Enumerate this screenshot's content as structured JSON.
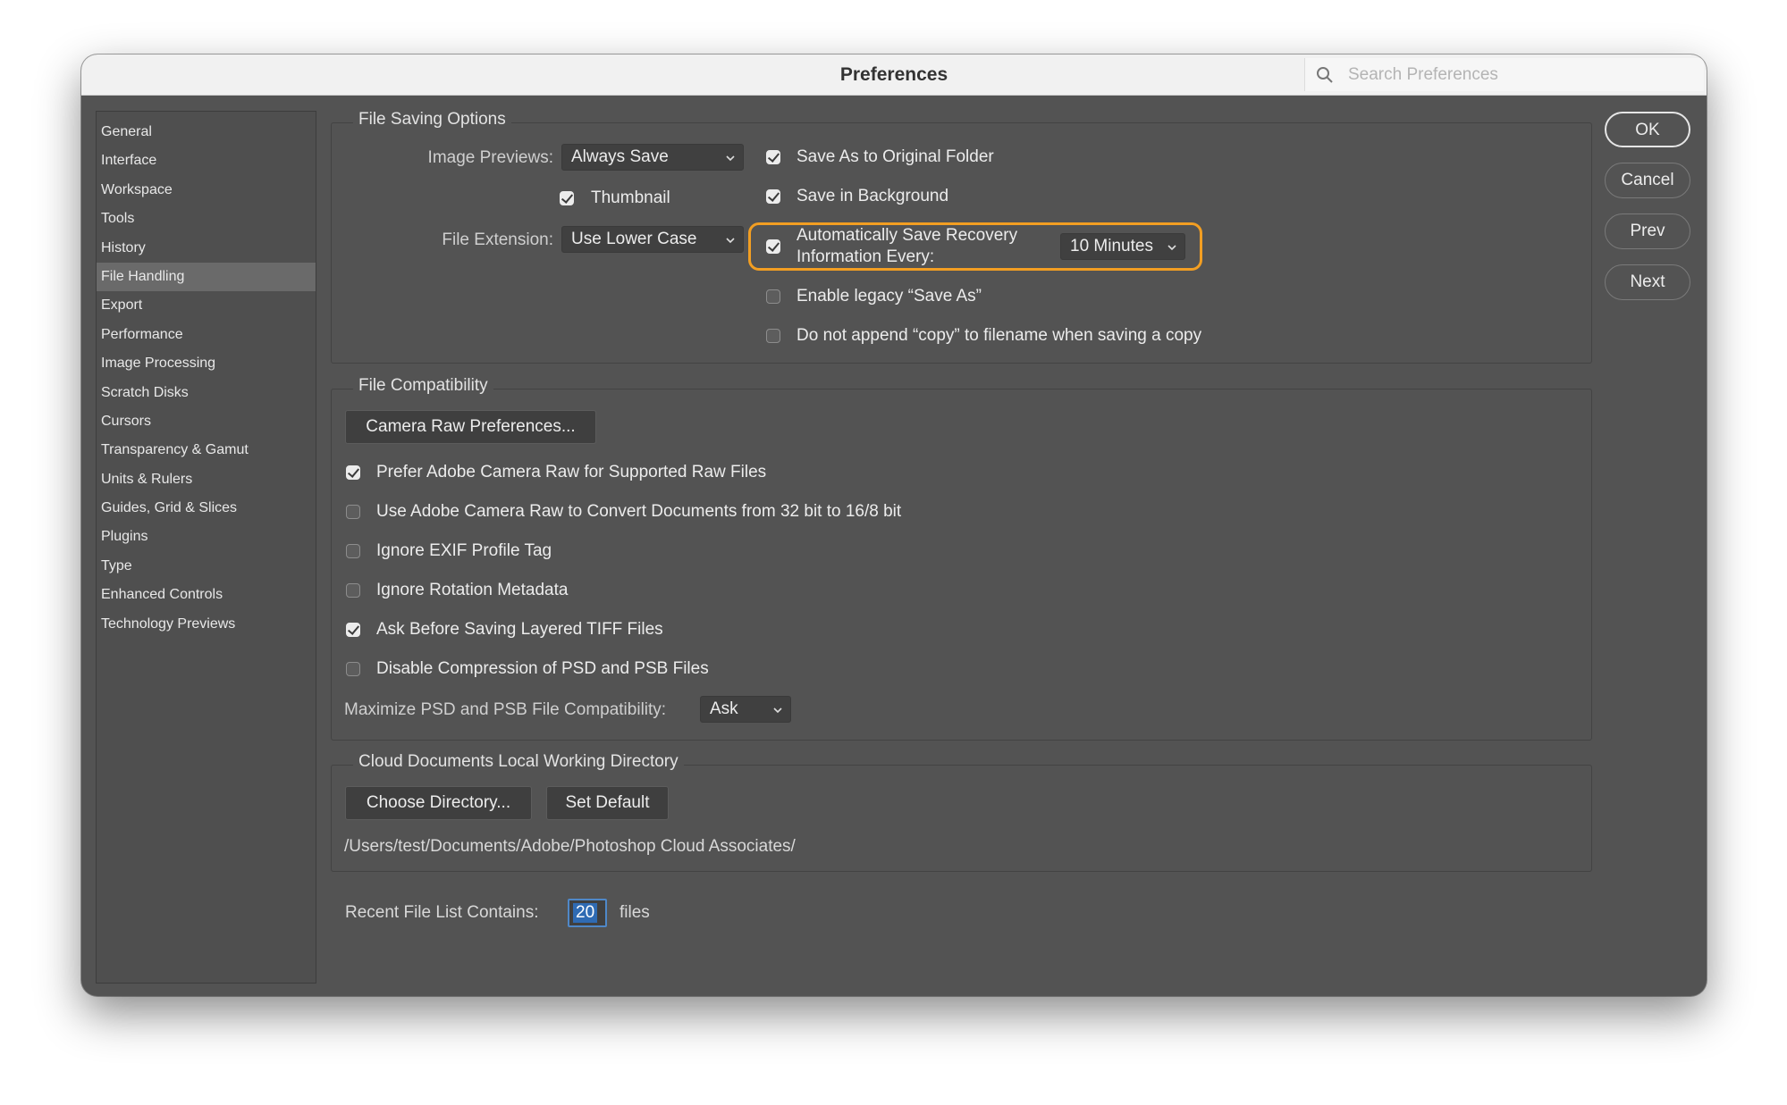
{
  "window": {
    "title": "Preferences",
    "search_placeholder": "Search Preferences"
  },
  "sidebar": {
    "items": [
      {
        "label": "General"
      },
      {
        "label": "Interface"
      },
      {
        "label": "Workspace"
      },
      {
        "label": "Tools"
      },
      {
        "label": "History"
      },
      {
        "label": "File Handling",
        "selected": true
      },
      {
        "label": "Export"
      },
      {
        "label": "Performance"
      },
      {
        "label": "Image Processing"
      },
      {
        "label": "Scratch Disks"
      },
      {
        "label": "Cursors"
      },
      {
        "label": "Transparency & Gamut"
      },
      {
        "label": "Units & Rulers"
      },
      {
        "label": "Guides, Grid & Slices"
      },
      {
        "label": "Plugins"
      },
      {
        "label": "Type"
      },
      {
        "label": "Enhanced Controls"
      },
      {
        "label": "Technology Previews"
      }
    ]
  },
  "file_saving": {
    "title": "File Saving Options",
    "image_previews_label": "Image Previews:",
    "image_previews_value": "Always Save",
    "thumbnail_label": "Thumbnail",
    "thumbnail_checked": true,
    "file_extension_label": "File Extension:",
    "file_extension_value": "Use Lower Case",
    "save_original_folder": {
      "label": "Save As to Original Folder",
      "checked": true
    },
    "save_background": {
      "label": "Save in Background",
      "checked": true
    },
    "auto_save": {
      "label_line1": "Automatically Save Recovery",
      "label_line2": "Information Every:",
      "checked": true,
      "interval": "10 Minutes"
    },
    "legacy_save_as": {
      "label": "Enable legacy “Save As”",
      "checked": false
    },
    "no_copy": {
      "label": "Do not append “copy” to filename when saving a copy",
      "checked": false
    }
  },
  "file_compat": {
    "title": "File Compatibility",
    "camera_raw_button": "Camera Raw Preferences...",
    "options": [
      {
        "label": "Prefer Adobe Camera Raw for Supported Raw Files",
        "checked": true
      },
      {
        "label": "Use Adobe Camera Raw to Convert Documents from 32 bit to 16/8 bit",
        "checked": false
      },
      {
        "label": "Ignore EXIF Profile Tag",
        "checked": false
      },
      {
        "label": "Ignore Rotation Metadata",
        "checked": false
      },
      {
        "label": "Ask Before Saving Layered TIFF Files",
        "checked": true
      },
      {
        "label": "Disable Compression of PSD and PSB Files",
        "checked": false
      }
    ],
    "maximize_label": "Maximize PSD and PSB File Compatibility:",
    "maximize_value": "Ask"
  },
  "cloud": {
    "title": "Cloud Documents Local Working Directory",
    "choose_button": "Choose Directory...",
    "default_button": "Set Default",
    "path": "/Users/test/Documents/Adobe/Photoshop Cloud Associates/"
  },
  "recent": {
    "label": "Recent File List Contains:",
    "value": "20",
    "suffix": "files"
  },
  "buttons": {
    "ok": "OK",
    "cancel": "Cancel",
    "prev": "Prev",
    "next": "Next"
  },
  "colors": {
    "panel": "#535353",
    "highlight": "#f29e22",
    "selection": "#2f6bb3"
  }
}
